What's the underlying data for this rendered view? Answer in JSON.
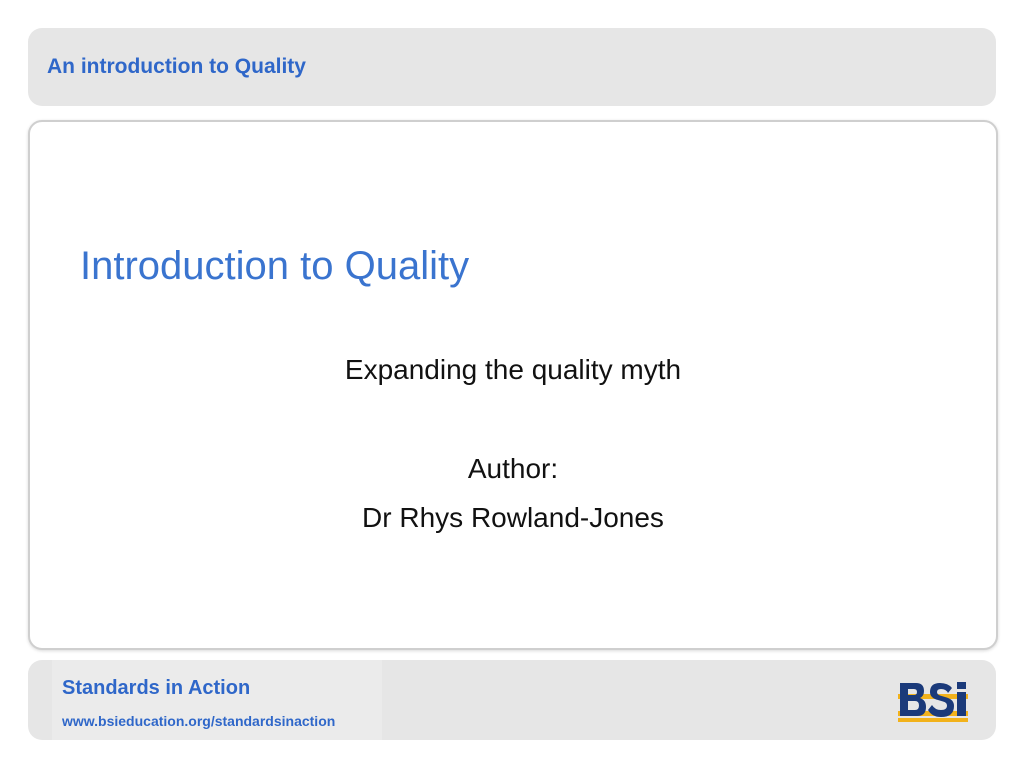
{
  "header": {
    "title": "An introduction to Quality"
  },
  "main": {
    "title": "Introduction to Quality",
    "subtitle_lines": [
      "Expanding the quality myth",
      "Author:",
      "Dr  Rhys Rowland-Jones"
    ]
  },
  "footer": {
    "title": "Standards in Action",
    "url": "www.bsieducation.org/standardsinaction",
    "logo": {
      "text": "BSi",
      "icon": "bsi-logo",
      "colors": {
        "letters": "#1b3a7a",
        "bar": "#f2b21b"
      }
    }
  },
  "colors": {
    "accent": "#2f67c9",
    "panel_gray": "#e6e6e6",
    "title_blue": "#3a74cf"
  }
}
